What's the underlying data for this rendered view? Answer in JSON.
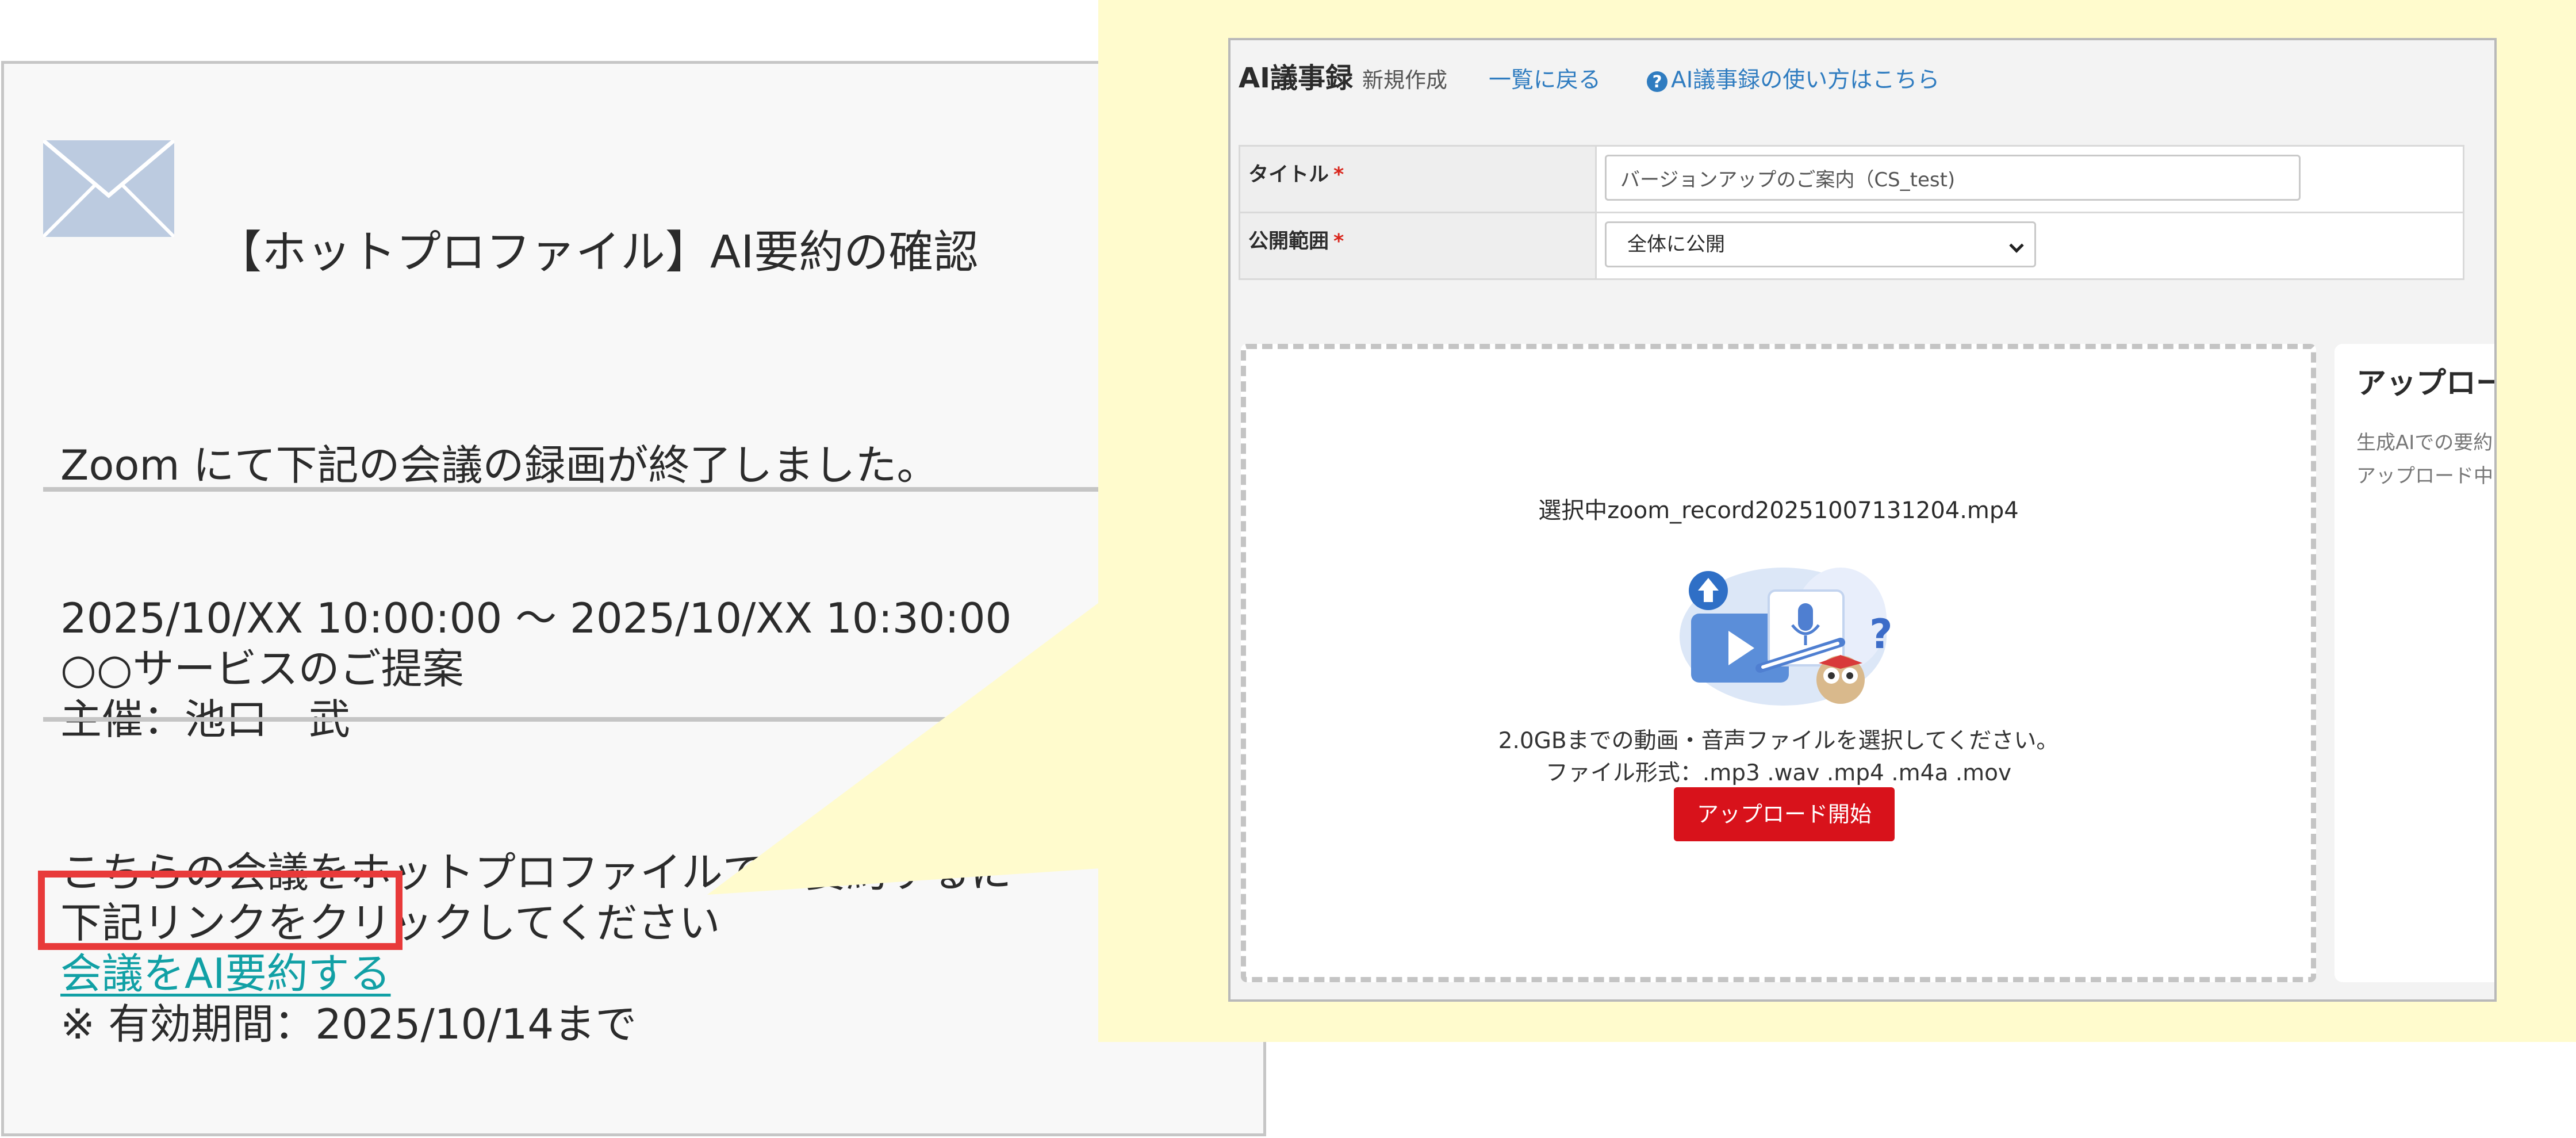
{
  "email": {
    "subject": "【ホットプロファイル】AI要約の確認",
    "intro": "Zoom にて下記の会議の録画が終了しました。",
    "meeting_time": "2025/10/XX 10:00:00 ～ 2025/10/XX 10:30:00",
    "meeting_name": "○○サービスのご提案",
    "host": "主催：池口　武",
    "instruction_1": "こちらの会議をホットプロファイルでAI要約するに",
    "instruction_2": "下記リンクをクリックしてください",
    "link_label": "会議をAI要約する",
    "validity": "※ 有効期間：2025/10/14まで"
  },
  "app": {
    "title": "AI議事録",
    "subtitle": "新規作成",
    "back_link": "一覧に戻る",
    "help_link": "AI議事録の使い方はこちら",
    "help_icon_glyph": "?",
    "form": {
      "title_label": "タイトル",
      "title_value": "バージョンアップのご案内（CS_test)",
      "scope_label": "公開範囲",
      "scope_value": "全体に公開",
      "required_mark": "*"
    },
    "upload": {
      "selected_file": "選択中zoom_record20251007131204.mp4",
      "hint_1": "2.0GBまでの動画・音声ファイルを選択してください。",
      "hint_2": "ファイル形式：.mp3 .wav .mp4 .m4a .mov",
      "button_label": "アップロード開始"
    },
    "side": {
      "title": "アップロー",
      "line_1": "生成AIでの要約",
      "line_2": "アップロード中"
    }
  },
  "colors": {
    "callout_bg": "#fffbcd",
    "link": "#11a0a5",
    "highlight_border": "#e83a3a",
    "app_link": "#2f7cc0",
    "upload_button": "#d8121b",
    "required": "#d9261c"
  },
  "icons": [
    "envelope-icon",
    "help-circle-icon",
    "chevron-down-icon",
    "upload-illustration"
  ]
}
